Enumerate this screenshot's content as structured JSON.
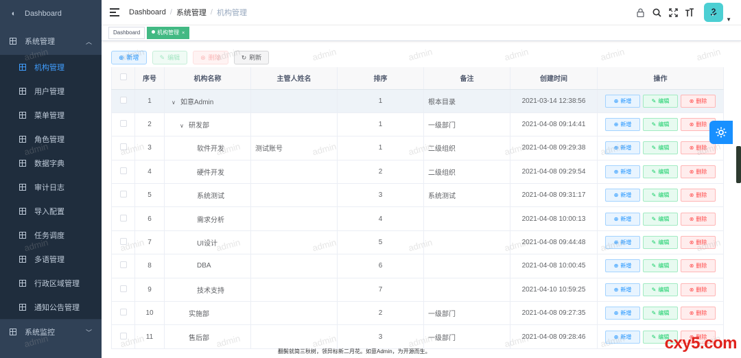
{
  "sidebar": {
    "dashboard": "Dashboard",
    "system_group": "系统管理",
    "items": [
      {
        "label": "机构管理",
        "active": true
      },
      {
        "label": "用户管理"
      },
      {
        "label": "菜单管理"
      },
      {
        "label": "角色管理"
      },
      {
        "label": "数据字典"
      },
      {
        "label": "审计日志"
      },
      {
        "label": "导入配置"
      },
      {
        "label": "任务调度"
      },
      {
        "label": "多语管理"
      },
      {
        "label": "行政区域管理"
      },
      {
        "label": "通知公告管理"
      }
    ],
    "monitor_group": "系统监控"
  },
  "header": {
    "breadcrumb": [
      "Dashboard",
      "系统管理",
      "机构管理"
    ],
    "icons": [
      "lock-icon",
      "search-icon",
      "fullscreen-icon",
      "font-size-icon"
    ]
  },
  "tags": {
    "items": [
      {
        "label": "Dashboard"
      },
      {
        "label": "机构管理",
        "active": true
      }
    ]
  },
  "toolbar": {
    "add": "新增",
    "edit": "编辑",
    "delete": "删除",
    "refresh": "刷新"
  },
  "table": {
    "headers": [
      "序号",
      "机构名称",
      "主管人姓名",
      "排序",
      "备注",
      "创建时间",
      "操作"
    ],
    "rows": [
      {
        "no": "1",
        "name": "如意Admin",
        "manager": "",
        "sort": "1",
        "remark": "根本目录",
        "created": "2021-03-14 12:38:56"
      },
      {
        "no": "2",
        "name": "研发部",
        "manager": "",
        "sort": "1",
        "remark": "一级部门",
        "created": "2021-04-08 09:14:41"
      },
      {
        "no": "3",
        "name": "软件开发",
        "manager": "测试账号",
        "sort": "1",
        "remark": "二级组织",
        "created": "2021-04-08 09:29:38"
      },
      {
        "no": "4",
        "name": "硬件开发",
        "manager": "",
        "sort": "2",
        "remark": "二级组织",
        "created": "2021-04-08 09:29:54"
      },
      {
        "no": "5",
        "name": "系统测试",
        "manager": "",
        "sort": "3",
        "remark": "系统测试",
        "created": "2021-04-08 09:31:17"
      },
      {
        "no": "6",
        "name": "需求分析",
        "manager": "",
        "sort": "4",
        "remark": "",
        "created": "2021-04-08 10:00:13"
      },
      {
        "no": "7",
        "name": "UI设计",
        "manager": "",
        "sort": "5",
        "remark": "",
        "created": "2021-04-08 09:44:48"
      },
      {
        "no": "8",
        "name": "DBA",
        "manager": "",
        "sort": "6",
        "remark": "",
        "created": "2021-04-08 10:00:45"
      },
      {
        "no": "9",
        "name": "技术支持",
        "manager": "",
        "sort": "7",
        "remark": "",
        "created": "2021-04-10 10:59:25"
      },
      {
        "no": "10",
        "name": "实施部",
        "manager": "",
        "sort": "2",
        "remark": "一级部门",
        "created": "2021-04-08 09:27:35"
      },
      {
        "no": "11",
        "name": "售后部",
        "manager": "",
        "sort": "3",
        "remark": "一级部门",
        "created": "2021-04-08 09:28:46"
      }
    ],
    "op": {
      "add": "新增",
      "edit": "编辑",
      "delete": "删除"
    }
  },
  "watermark": "admin",
  "footer": "翻鬓就简三秋树，领异标新二月花。如意Admin，为开源而生。",
  "site_logo": "cxy5.com",
  "colors": {
    "sidebar_bg": "#304156",
    "accent": "#409eff",
    "tag_active": "#42b983"
  }
}
